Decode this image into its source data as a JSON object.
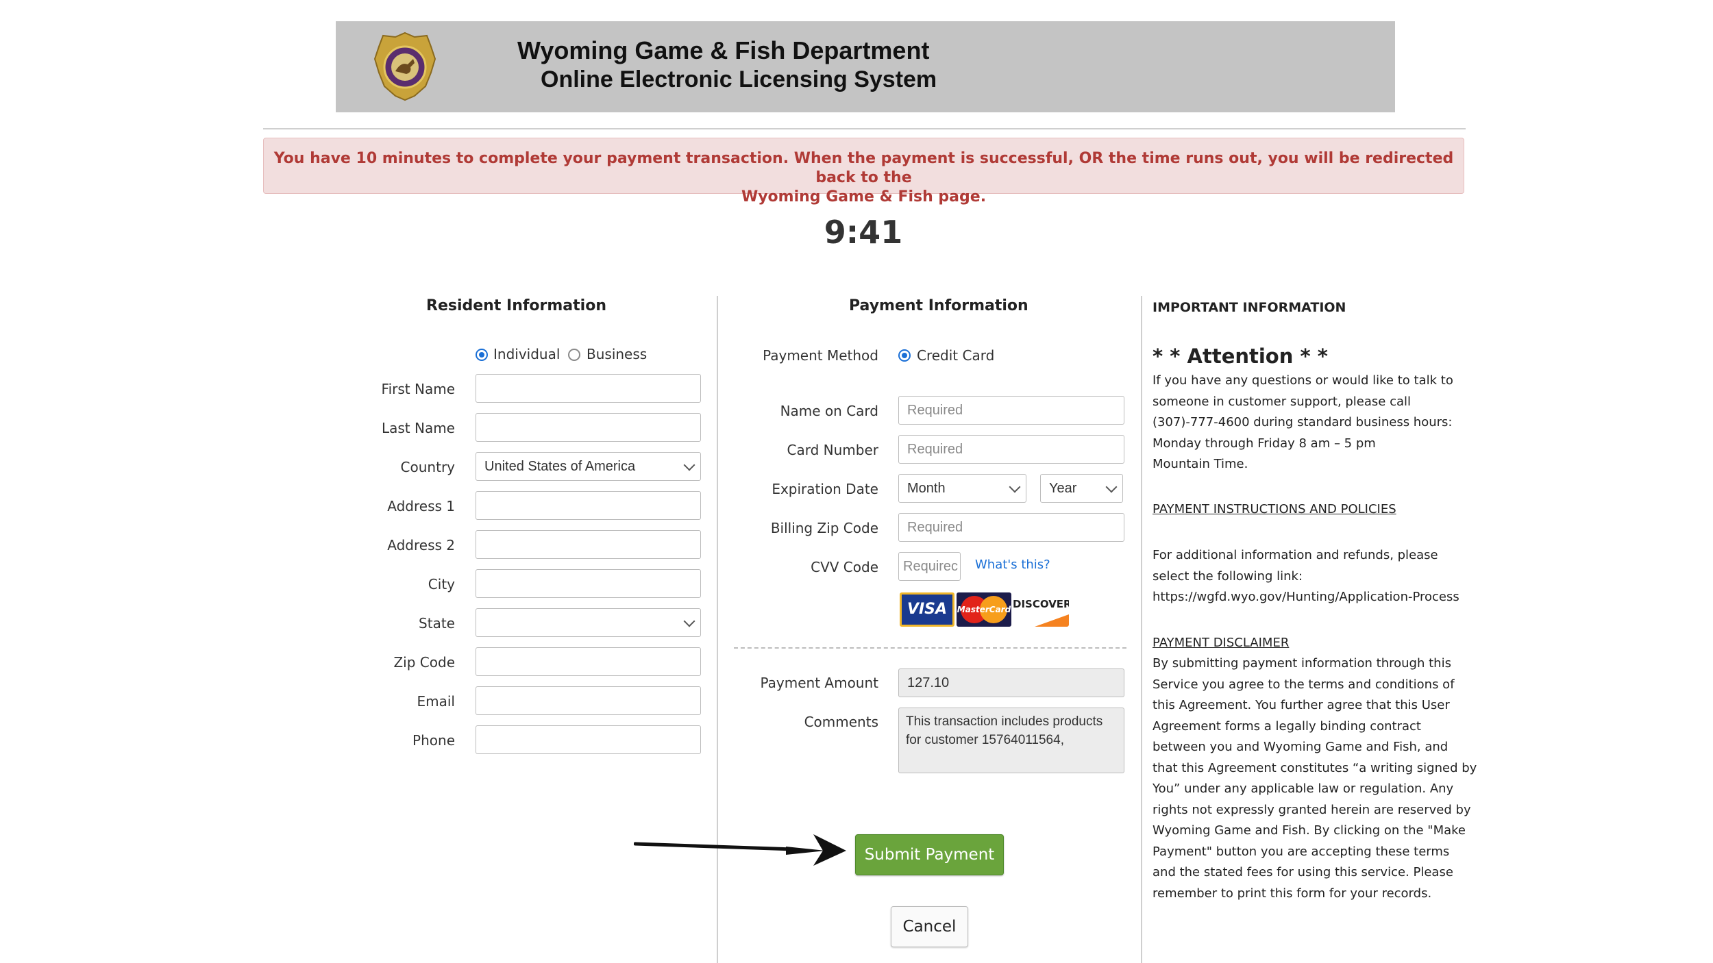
{
  "header": {
    "title": "Wyoming Game & Fish Department",
    "subtitle": "Online Electronic Licensing System"
  },
  "alert": {
    "line1": "You have 10 minutes to complete your payment transaction. When the payment is successful, OR the time runs out, you will be redirected back to the",
    "line2": "Wyoming Game & Fish page."
  },
  "timer": "9:41",
  "resident": {
    "title": "Resident Information",
    "type_options": [
      "Individual",
      "Business"
    ],
    "selected_type": "Individual",
    "fields": {
      "first_name": "First Name",
      "last_name": "Last Name",
      "country": "Country",
      "address1": "Address 1",
      "address2": "Address 2",
      "city": "City",
      "state": "State",
      "zip": "Zip Code",
      "email": "Email",
      "phone": "Phone"
    },
    "country_value": "United States of America",
    "state_value": ""
  },
  "payment": {
    "title": "Payment Information",
    "method_label": "Payment Method",
    "method_value": "Credit Card",
    "name_label": "Name on Card",
    "card_label": "Card Number",
    "exp_label": "Expiration Date",
    "zip_label": "Billing Zip Code",
    "cvv_label": "CVV Code",
    "placeholder": "Required",
    "cvv_placeholder": "Requirec",
    "month_value": "Month",
    "year_value": "Year",
    "whats_this": "What's this?",
    "cards": {
      "visa": "VISA",
      "mastercard": "MasterCard",
      "discover": "DISCOVER"
    },
    "amount_label": "Payment Amount",
    "amount_value": "127.10",
    "comments_label": "Comments",
    "comments_line1": "This transaction includes products",
    "comments_line2": "for customer 15764011564,",
    "submit": "Submit Payment",
    "cancel": "Cancel"
  },
  "info": {
    "title": "IMPORTANT INFORMATION",
    "attention": "* * Attention * *",
    "support_lines": [
      "If you have any questions or would like to talk to",
      "someone in customer support, please call",
      "(307)-777-4600 during standard business hours:",
      "Monday through Friday 8 am – 5 pm",
      "Mountain Time."
    ],
    "policies_heading": "PAYMENT INSTRUCTIONS AND POLICIES",
    "refund_lines": [
      "For additional information and refunds, please",
      "select the following link:",
      "https://wgfd.wyo.gov/Hunting/Application-Process"
    ],
    "disclaimer_heading": "PAYMENT DISCLAIMER",
    "disclaimer_lines": [
      "By submitting payment information through this",
      "Service you agree to the terms and conditions of",
      "this Agreement. You further agree that this User",
      "Agreement forms a legally binding contract",
      "between you and Wyoming Game and Fish, and",
      "that this Agreement constitutes “a writing signed by",
      "You” under any applicable law or regulation. Any",
      "rights not expressly granted herein are reserved by",
      "Wyoming Game and Fish. By clicking on the \"Make",
      "Payment\" button you are accepting these terms",
      "and the stated fees for using this service. Please",
      "remember to print this form for your records."
    ]
  },
  "colors": {
    "banner": "#c4c4c4",
    "alert_bg": "#f2dede",
    "alert_text": "#b03a36",
    "submit_green": "#6aa43c",
    "link_blue": "#1a6fd6"
  }
}
